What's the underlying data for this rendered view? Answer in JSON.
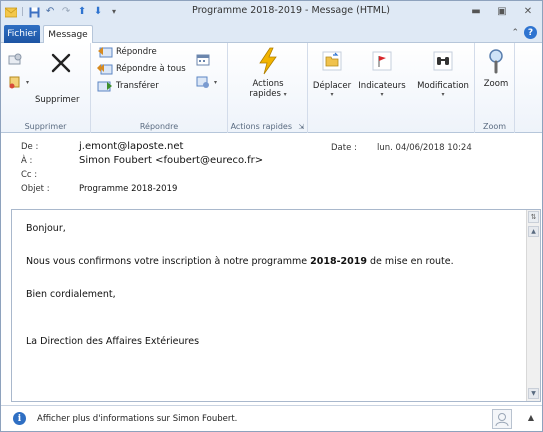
{
  "window": {
    "title": "Programme 2018-2019  -  Message (HTML)"
  },
  "tabs": {
    "file": "Fichier",
    "message": "Message"
  },
  "ribbon": {
    "groups": {
      "delete": {
        "label": "Supprimer",
        "delete_btn": "Supprimer"
      },
      "respond": {
        "label": "Répondre",
        "reply": "Répondre",
        "reply_all": "Répondre à tous",
        "forward": "Transférer"
      },
      "quick": {
        "label": "Actions rapides",
        "button": "Actions",
        "button2": "rapides"
      },
      "move": {
        "button": "Déplacer"
      },
      "tags": {
        "button": "Indicateurs"
      },
      "edit": {
        "button": "Modification"
      },
      "zoom": {
        "label": "Zoom",
        "button": "Zoom"
      }
    }
  },
  "headers": {
    "from_label": "De :",
    "from_value": "j.emont@laposte.net",
    "to_label": "À :",
    "to_value": "Simon Foubert <foubert@eureco.fr>",
    "cc_label": "Cc :",
    "cc_value": "",
    "subject_label": "Objet :",
    "subject_value": "Programme 2018-2019",
    "date_label": "Date :",
    "date_value": "lun. 04/06/2018 10:24"
  },
  "body": {
    "greeting": "Bonjour,",
    "line1_pre": "Nous vous confirmons votre inscription à notre programme ",
    "line1_bold": "2018-2019",
    "line1_post": " de mise en route.",
    "closing": "Bien cordialement,",
    "signature": "La Direction des Affaires Extérieures"
  },
  "infobar": {
    "text": "Afficher plus d'informations sur Simon Foubert."
  },
  "colors": {
    "file_tab": "#2f6fc3",
    "accent_blue": "#2f74d0",
    "lightning": "#f2b400",
    "flag_red": "#d8262b"
  }
}
